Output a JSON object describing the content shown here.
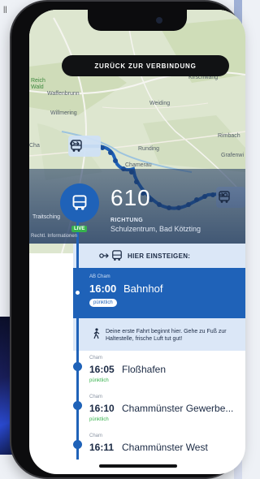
{
  "nav": {
    "back_label": "ZURÜCK ZUR VERBINDUNG"
  },
  "map_labels": {
    "top_right": "Kirschwang",
    "tl_1": "Reich",
    "tl_2": "Wald",
    "waffenbrunn": "Waffenbrunn",
    "willmering": "Willmering",
    "weiding": "Weiding",
    "rimbach": "Rimbach",
    "runding": "Runding",
    "chamerau": "Chamerau",
    "chame": "Cha",
    "grafenwiese": "Grafenwi",
    "traitsching": "Traitsching",
    "copyright": "Rechtl. Informationen"
  },
  "route": {
    "line_number": "610",
    "direction_label": "RICHTUNG",
    "direction": "Schulzentrum, Bad Kötzting",
    "live_label": "LIVE"
  },
  "boarding": {
    "label": "HIER EINSTEIGEN:"
  },
  "active_stop": {
    "meta": "AB  Cham",
    "time": "16:00",
    "name": "Bahnhof",
    "status": "pünktlich"
  },
  "walk_note": "Deine erste Fahrt beginnt hier. Gehe zu Fuß zur Haltestelle, frische Luft tut gut!",
  "stops": [
    {
      "meta": "Cham",
      "time": "16:05",
      "name": "Floßhafen",
      "status": "pünktlich"
    },
    {
      "meta": "Cham",
      "time": "16:10",
      "name": "Chammünster Gewerbe...",
      "status": "pünktlich"
    },
    {
      "meta": "Cham",
      "time": "16:11",
      "name": "Chammünster West",
      "status": ""
    }
  ],
  "colors": {
    "primary": "#1f62b8",
    "live": "#37b24d",
    "pale": "#dbe7f7"
  },
  "icons": [
    "bus-icon",
    "walk-icon",
    "arrow-enter-icon"
  ]
}
